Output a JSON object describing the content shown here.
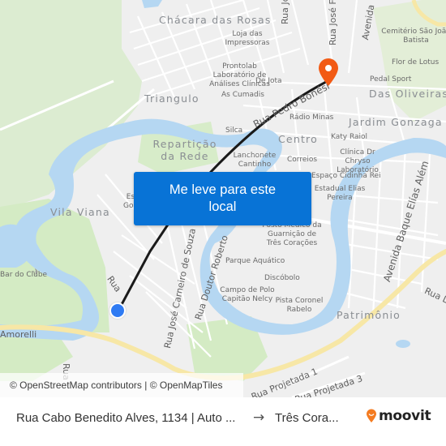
{
  "map": {
    "cta_button": "Me leve para este local",
    "attribution": "© OpenStreetMap contributors | © OpenMapTiles",
    "neighborhoods": [
      "Chácara das Rosas",
      "Triangulo",
      "Repartição da Rede",
      "Centro",
      "Das Oliveiras",
      "Jardim Gonzaga",
      "Vila Viana",
      "Patrimônio"
    ],
    "streets": [
      "Rua João X",
      "Rua José F",
      "Avenida",
      "Rua Pedro Bonési",
      "Rua José Carneiro de Souza",
      "Rua Doutor Roberto",
      "Avenida Baque Elías Além",
      "Rua L",
      "Rua Projetada 1",
      "Rua Projetada 3",
      "Amorelli",
      "Rua",
      "Rua Jose"
    ],
    "pois": [
      "Loja das Impressoras",
      "Prontolab Laboratório de Análises Clínicas",
      "De Jota",
      "As Cumadis",
      "Silca",
      "Rádio Minas",
      "Lanchonete Cantinho",
      "Correios",
      "Katy Raiol",
      "Clínica Dr Chryso Laboratório",
      "Flor de Lotus",
      "Pedal Sport",
      "Cemitério São João Batista",
      "Espaço Cidinha Rei",
      "Estadual Elias Pereira",
      "Posto Médico da Guarnição de Três Corações",
      "Parque Aquático",
      "Discóbolo",
      "Campo de Polo Capitão Nelcy",
      "Pista Coronel Rabelo",
      "Bar do Clube",
      "Es Goo"
    ],
    "origin_marker": "origin-dot",
    "destination_marker": "destination-pin",
    "colors": {
      "water": "#b5d7f2",
      "park": "#d4ebc4",
      "land": "#efefef",
      "road": "#ffffff",
      "major_road": "#f7e7a6",
      "route_line": "#1a1a1a",
      "origin": "#2f7bf3",
      "destination": "#f25a14",
      "cta": "#0873d6"
    }
  },
  "footer": {
    "origin": "Rua Cabo Benedito Alves, 1134 | Auto ...",
    "arrow": "→",
    "destination": "Três Cora...",
    "brand": "moovit",
    "brand_color": "#f47b20"
  }
}
